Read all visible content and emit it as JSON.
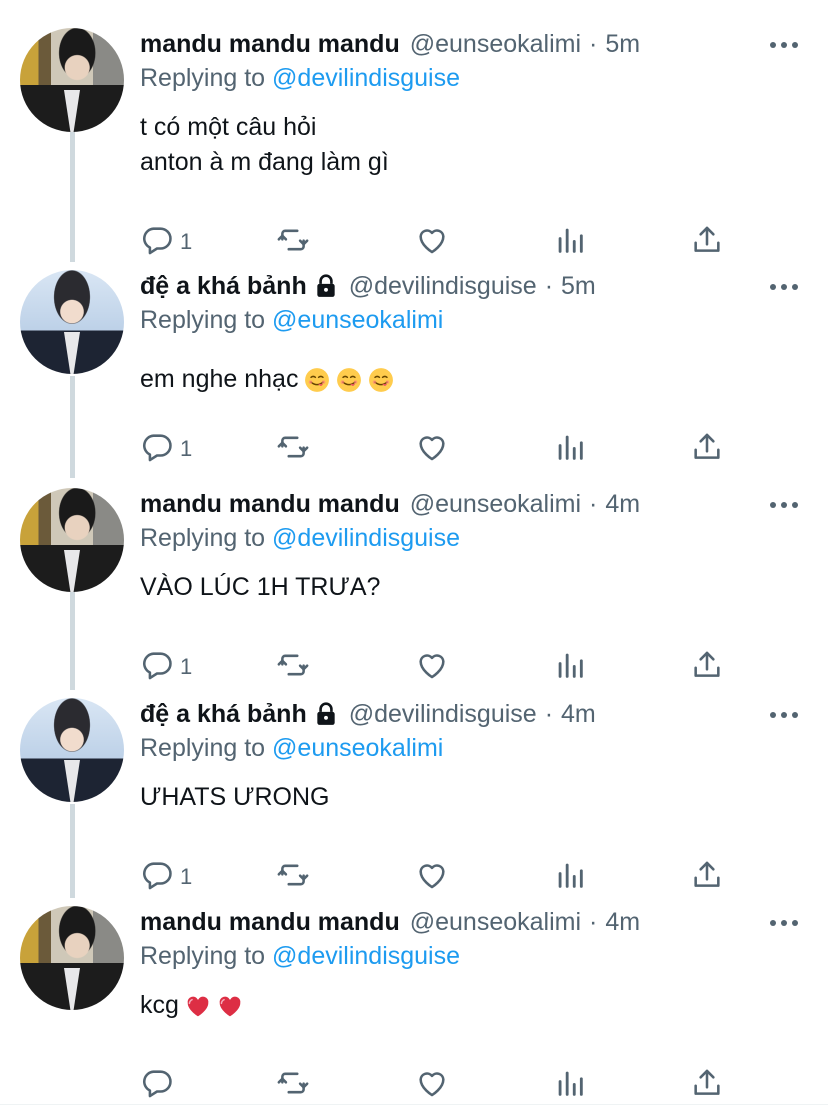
{
  "tweets": [
    {
      "name": "mandu mandu mandu",
      "locked": false,
      "handle": "@eunseokalimi",
      "time": "5m",
      "replying_prefix": "Replying to ",
      "replying_to": "@devilindisguise",
      "lines": [
        "t có một câu hỏi",
        "anton à m đang làm gì"
      ],
      "emojis": [],
      "reply_count": "1",
      "avatar_style": "dark"
    },
    {
      "name": "đệ a khá bảnh",
      "locked": true,
      "handle": "@devilindisguise",
      "time": "5m",
      "replying_prefix": "Replying to ",
      "replying_to": "@eunseokalimi",
      "lines": [
        "em nghe nhạc"
      ],
      "emojis": [
        "yum-face-icon",
        "yum-face-icon",
        "yum-face-icon"
      ],
      "reply_count": "1",
      "avatar_style": "light"
    },
    {
      "name": "mandu mandu mandu",
      "locked": false,
      "handle": "@eunseokalimi",
      "time": "4m",
      "replying_prefix": "Replying to ",
      "replying_to": "@devilindisguise",
      "lines": [
        "VÀO LÚC 1H TRƯA?"
      ],
      "emojis": [],
      "reply_count": "1",
      "avatar_style": "dark"
    },
    {
      "name": "đệ a khá bảnh",
      "locked": true,
      "handle": "@devilindisguise",
      "time": "4m",
      "replying_prefix": "Replying to ",
      "replying_to": "@eunseokalimi",
      "lines": [
        "ƯHATS ƯRONG"
      ],
      "emojis": [],
      "reply_count": "1",
      "avatar_style": "light"
    },
    {
      "name": "mandu mandu mandu",
      "locked": false,
      "handle": "@eunseokalimi",
      "time": "4m",
      "replying_prefix": "Replying to ",
      "replying_to": "@devilindisguise",
      "lines": [
        "kcg"
      ],
      "emojis": [
        "red-heart-icon",
        "red-heart-icon"
      ],
      "reply_count": "",
      "avatar_style": "dark"
    }
  ],
  "separator": "·",
  "colors": {
    "text": "#0f1419",
    "secondary": "#536471",
    "link": "#1d9bf0",
    "thread_line": "#cfd9de"
  }
}
